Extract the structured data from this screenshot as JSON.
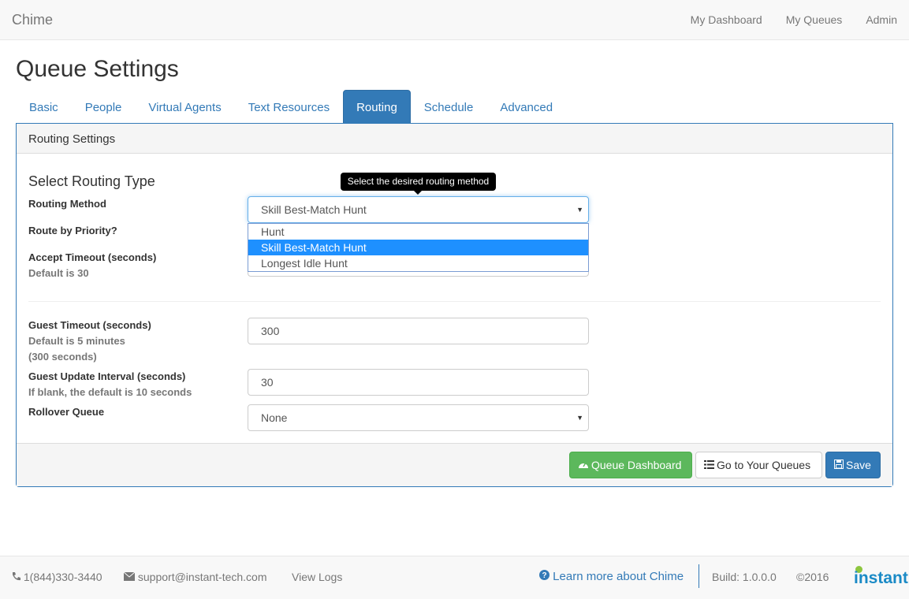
{
  "navbar": {
    "brand": "Chime",
    "links": [
      "My Dashboard",
      "My Queues",
      "Admin"
    ]
  },
  "page": {
    "title": "Queue Settings"
  },
  "tabs": [
    {
      "label": "Basic",
      "active": false
    },
    {
      "label": "People",
      "active": false
    },
    {
      "label": "Virtual Agents",
      "active": false
    },
    {
      "label": "Text Resources",
      "active": false
    },
    {
      "label": "Routing",
      "active": true
    },
    {
      "label": "Schedule",
      "active": false
    },
    {
      "label": "Advanced",
      "active": false
    }
  ],
  "panel": {
    "heading": "Routing Settings",
    "section_title": "Select Routing Type",
    "tooltip": "Select the desired routing method",
    "routing_method": {
      "label": "Routing Method",
      "value": "Skill Best-Match Hunt",
      "options": [
        "Hunt",
        "Skill Best-Match Hunt",
        "Longest Idle Hunt"
      ],
      "selected_option": "Skill Best-Match Hunt"
    },
    "route_by_priority": {
      "label": "Route by Priority?"
    },
    "accept_timeout": {
      "label": "Accept Timeout (seconds)",
      "help": "Default is 30"
    },
    "guest_timeout": {
      "label": "Guest Timeout (seconds)",
      "help_line1": "Default is 5 minutes",
      "help_line2": "(300 seconds)",
      "value": "300"
    },
    "guest_update_interval": {
      "label": "Guest Update Interval (seconds)",
      "help": "If blank, the default is 10 seconds",
      "value": "30"
    },
    "rollover_queue": {
      "label": "Rollover Queue",
      "value": "None"
    },
    "buttons": {
      "queue_dashboard": "Queue Dashboard",
      "go_to_queues": "Go to Your Queues",
      "save": "Save"
    }
  },
  "footer": {
    "phone": "1(844)330-3440",
    "email": "support@instant-tech.com",
    "view_logs": "View Logs",
    "learn_more": "Learn more about Chime",
    "build": "Build: 1.0.0.0",
    "copyright": "©2016",
    "logo_text": "instant"
  },
  "colors": {
    "primary": "#337ab7",
    "success": "#5cb85c",
    "selected_option": "#1e90ff"
  },
  "icons": {
    "dashboard": "dashboard-icon",
    "list": "list-icon",
    "save": "floppy-icon",
    "phone": "phone-icon",
    "email": "envelope-icon",
    "help": "question-circle-icon"
  }
}
